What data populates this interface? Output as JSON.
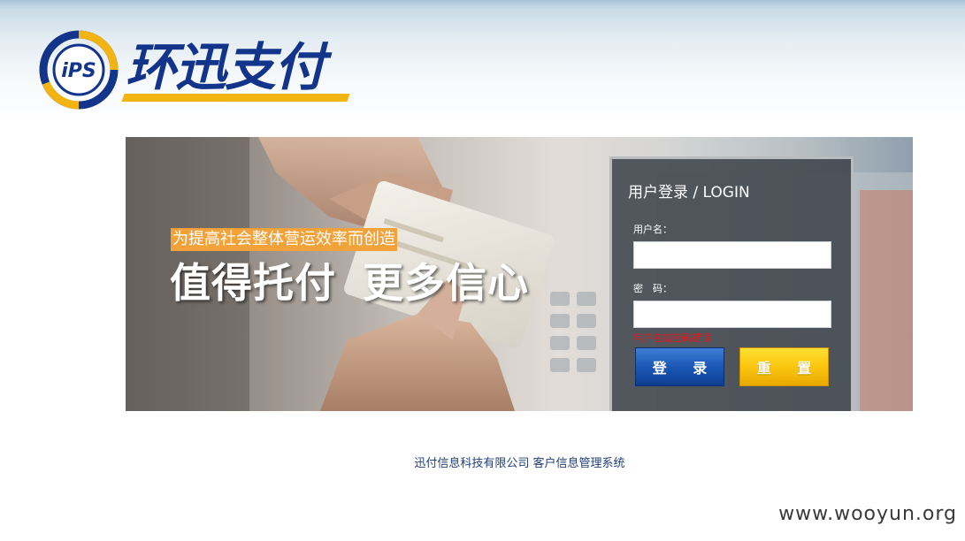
{
  "logo": {
    "mark_text": "iPS",
    "brand_name": "环迅支付"
  },
  "banner": {
    "tagline": "为提高社会整体营运效率而创造",
    "slogan_part1": "值得托付",
    "slogan_part2": "更多信心"
  },
  "login": {
    "title": "用户登录 / LOGIN",
    "username_label": "用户名：",
    "username_value": "",
    "password_label": "密　码：",
    "password_value": "",
    "error_message": "用户名或密码错误",
    "login_button": "登 录",
    "reset_button": "重 置"
  },
  "footer": {
    "text": "迅付信息科技有限公司 客户信息管理系统"
  },
  "watermark": {
    "text": "www.wooyun.org"
  },
  "colors": {
    "brand_blue": "#12348a",
    "brand_yellow": "#f3b312",
    "tagline_bg": "#f3a23a",
    "error_red": "#e8161c",
    "login_blue": "#1a58b7",
    "reset_yellow": "#fbc60d"
  }
}
